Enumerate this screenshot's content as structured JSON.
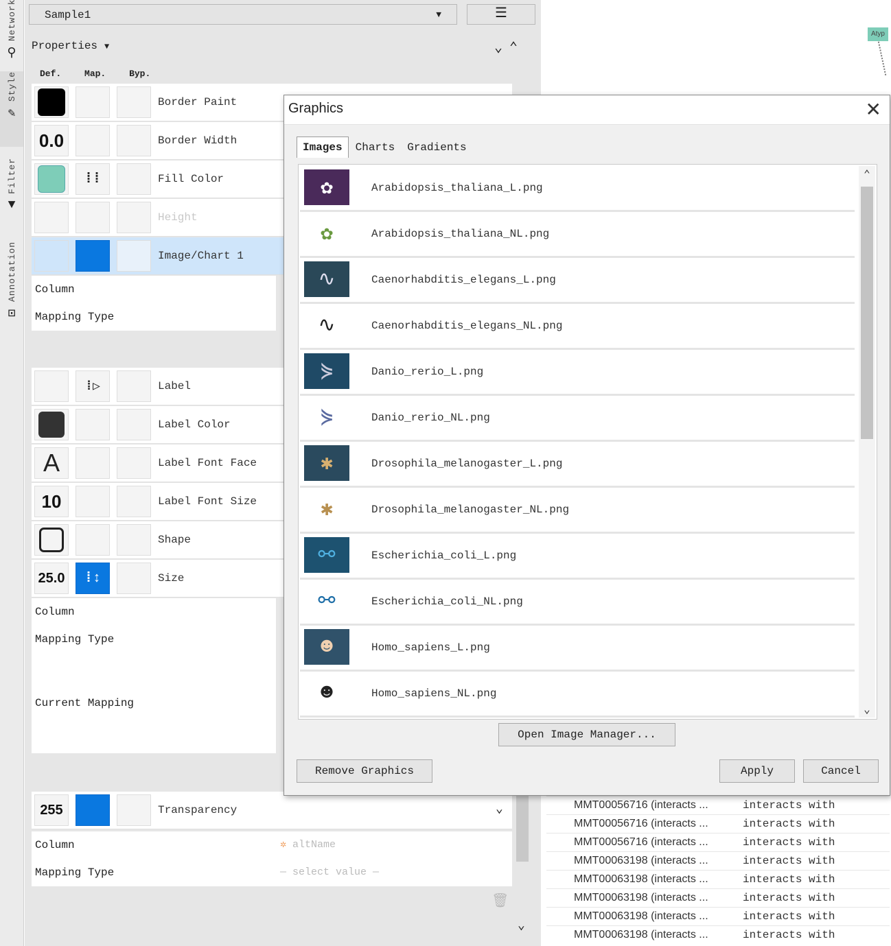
{
  "left_tabs": [
    {
      "label": "Network",
      "icon": "network-icon"
    },
    {
      "label": "Style",
      "icon": "brush-icon"
    },
    {
      "label": "Filter",
      "icon": "filter-icon"
    },
    {
      "label": "Annotation",
      "icon": "annotation-icon"
    }
  ],
  "style_panel": {
    "style_name": "Sample1",
    "properties_label": "Properties",
    "col_headers": [
      "Def.",
      "Map.",
      "Byp."
    ],
    "properties": [
      {
        "name": "Border Paint"
      },
      {
        "name": "Border Width",
        "def_value": "0.0"
      },
      {
        "name": "Fill Color"
      },
      {
        "name": "Height"
      },
      {
        "name": "Image/Chart 1"
      },
      {
        "name": "Label"
      },
      {
        "name": "Label Color"
      },
      {
        "name": "Label Font Face",
        "def_value": "A"
      },
      {
        "name": "Label Font Size",
        "def_value": "10"
      },
      {
        "name": "Shape"
      },
      {
        "name": "Size",
        "def_value": "25.0"
      },
      {
        "name": "Transparency",
        "def_value": "255"
      }
    ],
    "mapping_rows": {
      "column": "Column",
      "mapping_type": "Mapping Type",
      "current_mapping": "Current Mapping",
      "column_value": "altName",
      "mapping_value": "select value"
    }
  },
  "network_node_label": "Atyp",
  "edge_table": {
    "rows": [
      {
        "name": "MMT00056716 (interacts ...",
        "type": "interacts with"
      },
      {
        "name": "MMT00056716 (interacts ...",
        "type": "interacts with"
      },
      {
        "name": "MMT00056716 (interacts ...",
        "type": "interacts with"
      },
      {
        "name": "MMT00063198 (interacts ...",
        "type": "interacts with"
      },
      {
        "name": "MMT00063198 (interacts ...",
        "type": "interacts with"
      },
      {
        "name": "MMT00063198 (interacts ...",
        "type": "interacts with"
      },
      {
        "name": "MMT00063198 (interacts ...",
        "type": "interacts with"
      },
      {
        "name": "MMT00063198 (interacts ...",
        "type": "interacts with"
      }
    ]
  },
  "dialog": {
    "title": "Graphics",
    "tabs": [
      "Images",
      "Charts",
      "Gradients"
    ],
    "images": [
      {
        "name": "Arabidopsis_thaliana_L.png",
        "thumb": "flower-icon"
      },
      {
        "name": "Arabidopsis_thaliana_NL.png",
        "thumb": "flower-icon"
      },
      {
        "name": "Caenorhabditis_elegans_L.png",
        "thumb": "worm-icon"
      },
      {
        "name": "Caenorhabditis_elegans_NL.png",
        "thumb": "worm-icon"
      },
      {
        "name": "Danio_rerio_L.png",
        "thumb": "fish-icon"
      },
      {
        "name": "Danio_rerio_NL.png",
        "thumb": "fish-icon"
      },
      {
        "name": "Drosophila_melanogaster_L.png",
        "thumb": "fly-icon"
      },
      {
        "name": "Drosophila_melanogaster_NL.png",
        "thumb": "fly-icon"
      },
      {
        "name": "Escherichia_coli_L.png",
        "thumb": "bacteria-icon"
      },
      {
        "name": "Escherichia_coli_NL.png",
        "thumb": "bacteria-icon"
      },
      {
        "name": "Homo_sapiens_L.png",
        "thumb": "person-icon"
      },
      {
        "name": "Homo_sapiens_NL.png",
        "thumb": "person-icon"
      }
    ],
    "open_manager_label": "Open Image Manager...",
    "remove_label": "Remove Graphics",
    "apply_label": "Apply",
    "cancel_label": "Cancel"
  },
  "colors": {
    "accent_blue": "#0a78e0",
    "fill_teal": "#7ecdb8",
    "selected_row": "#cfe5fa"
  }
}
